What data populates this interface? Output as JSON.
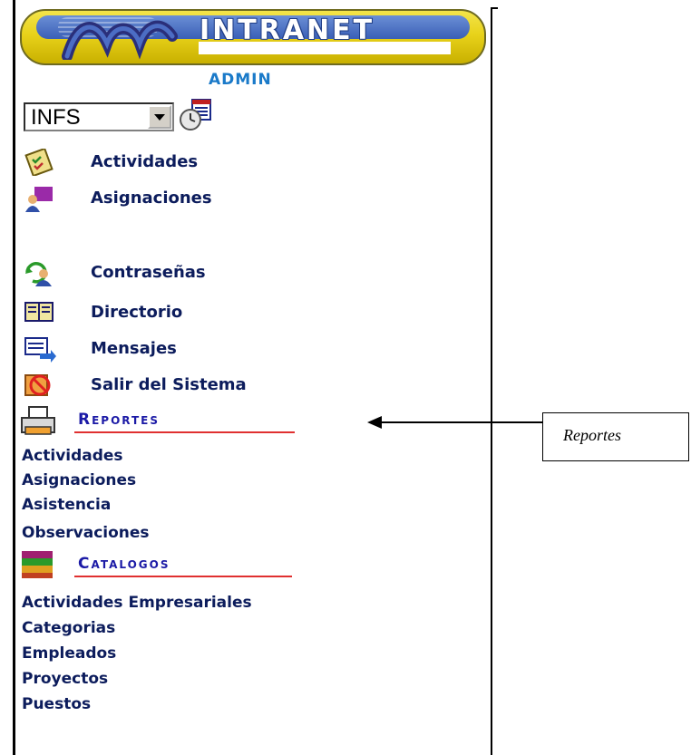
{
  "header": {
    "logo_text": "INTRANET",
    "user_label": "ADMIN"
  },
  "selector": {
    "value": "INFS"
  },
  "menu": [
    {
      "label": "Actividades",
      "icon": "activities-icon"
    },
    {
      "label": "Asignaciones",
      "icon": "assignments-icon"
    },
    {
      "label": "Contraseñas",
      "icon": "passwords-icon"
    },
    {
      "label": "Directorio",
      "icon": "directory-icon"
    },
    {
      "label": "Mensajes",
      "icon": "messages-icon"
    },
    {
      "label": "Salir del Sistema",
      "icon": "logout-icon"
    }
  ],
  "reportes": {
    "title": "Reportes",
    "links": [
      "Actividades",
      "Asignaciones",
      "Asistencia",
      "Observaciones"
    ]
  },
  "catalogos": {
    "title": "Catalogos",
    "links": [
      "Actividades Empresariales",
      "Categorias",
      "Empleados",
      "Proyectos",
      "Puestos"
    ]
  },
  "annotation": {
    "callout_text": "Reportes"
  },
  "colors": {
    "link": "#0c1c5c",
    "admin": "#1a7ac9",
    "section": "#1b1aa6",
    "underline": "#e03030"
  }
}
